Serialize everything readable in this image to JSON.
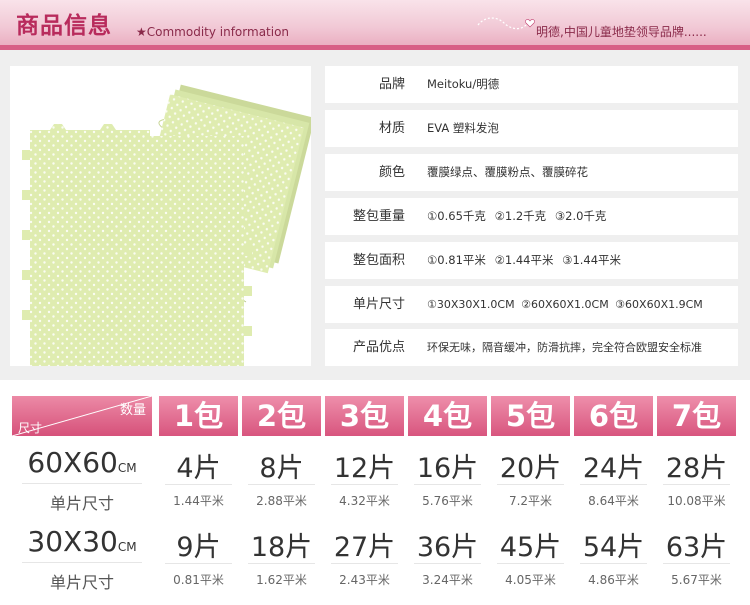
{
  "header": {
    "title": "商品信息",
    "subtitle": "★Commodity information",
    "slogan": "明德,中国儿童地垫领导品牌......"
  },
  "specs": [
    {
      "label": "品牌",
      "value": "Meitoku/明德"
    },
    {
      "label": "材质",
      "value": "EVA 塑料发泡"
    },
    {
      "label": "颜色",
      "value": "覆膜绿点、覆膜粉点、覆膜碎花"
    },
    {
      "label": "整包重量",
      "value": "①0.65千克 ②1.2千克 ③2.0千克"
    },
    {
      "label": "整包面积",
      "value": "①0.81平米 ②1.44平米 ③1.44平米"
    },
    {
      "label": "单片尺寸",
      "value": "①30X30X1.0CM ②60X60X1.0CM ③60X60X1.9CM"
    },
    {
      "label": "产品优点",
      "value": "环保无味，隔音缓冲，防滑抗摔，完全符合欧盟安全标准"
    }
  ],
  "table": {
    "corner_top": "数量",
    "corner_bottom": "尺寸",
    "packs": [
      "1包",
      "2包",
      "3包",
      "4包",
      "5包",
      "6包",
      "7包"
    ],
    "rows": [
      {
        "size": "60X60",
        "unit": "CM",
        "caption": "单片尺寸",
        "pieces": [
          "4片",
          "8片",
          "12片",
          "16片",
          "20片",
          "24片",
          "28片"
        ],
        "areas": [
          "1.44平米",
          "2.88平米",
          "4.32平米",
          "5.76平米",
          "7.2平米",
          "8.64平米",
          "10.08平米"
        ]
      },
      {
        "size": "30X30",
        "unit": "CM",
        "caption": "单片尺寸",
        "pieces": [
          "9片",
          "18片",
          "27片",
          "36片",
          "45片",
          "54片",
          "63片"
        ],
        "areas": [
          "0.81平米",
          "1.62平米",
          "2.43平米",
          "3.24平米",
          "4.05平米",
          "4.86平米",
          "5.67平米"
        ]
      }
    ]
  },
  "colors": {
    "brand_pink": "#d6517a",
    "mat_green": "#dfecb0"
  }
}
